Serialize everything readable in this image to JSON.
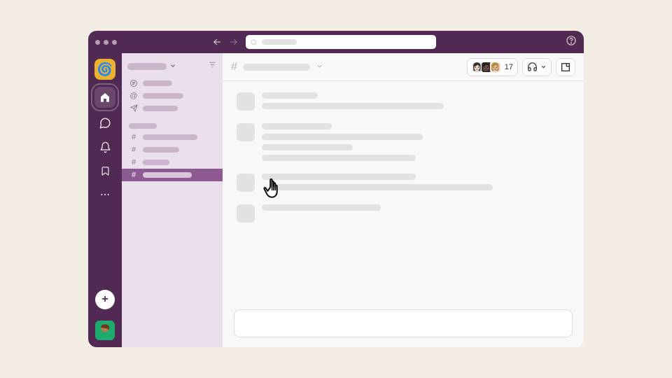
{
  "colors": {
    "brand": "#512a53",
    "accent": "#ecb22e",
    "sidebar": "#ecdfed",
    "selected": "#8e5a93"
  },
  "titlebar": {
    "back_label": "Back",
    "forward_label": "Forward",
    "search_placeholder": "Search",
    "help_label": "Help"
  },
  "rail": {
    "workspace_logo": "🌀",
    "items": [
      {
        "name": "home",
        "label": "Home",
        "active": true
      },
      {
        "name": "dms",
        "label": "DMs"
      },
      {
        "name": "activity",
        "label": "Activity"
      },
      {
        "name": "later",
        "label": "Later"
      },
      {
        "name": "more",
        "label": "More"
      }
    ],
    "create_label": "+",
    "user_avatar": "👩🏽"
  },
  "sidebar": {
    "workspace_name": "",
    "filter_label": "Filter",
    "sections": [
      {
        "icon": "message-circle",
        "label": ""
      },
      {
        "icon": "at",
        "label": ""
      },
      {
        "icon": "send",
        "label": ""
      }
    ],
    "channels_heading": "",
    "channels": [
      {
        "prefix": "#",
        "label": "",
        "selected": false
      },
      {
        "prefix": "#",
        "label": "",
        "selected": false
      },
      {
        "prefix": "#",
        "label": "",
        "selected": false
      },
      {
        "prefix": "#",
        "label": "",
        "selected": true
      }
    ]
  },
  "channel": {
    "prefix": "#",
    "name": "",
    "member_count": "17",
    "huddle_label": "Huddle",
    "canvas_label": "Canvas"
  },
  "messages": [
    {
      "lines": [
        80,
        260
      ]
    },
    {
      "lines": [
        100,
        230,
        130,
        220
      ]
    },
    {
      "lines": [
        220,
        310
      ]
    },
    {
      "lines": [
        170
      ]
    }
  ],
  "composer": {
    "placeholder": ""
  }
}
